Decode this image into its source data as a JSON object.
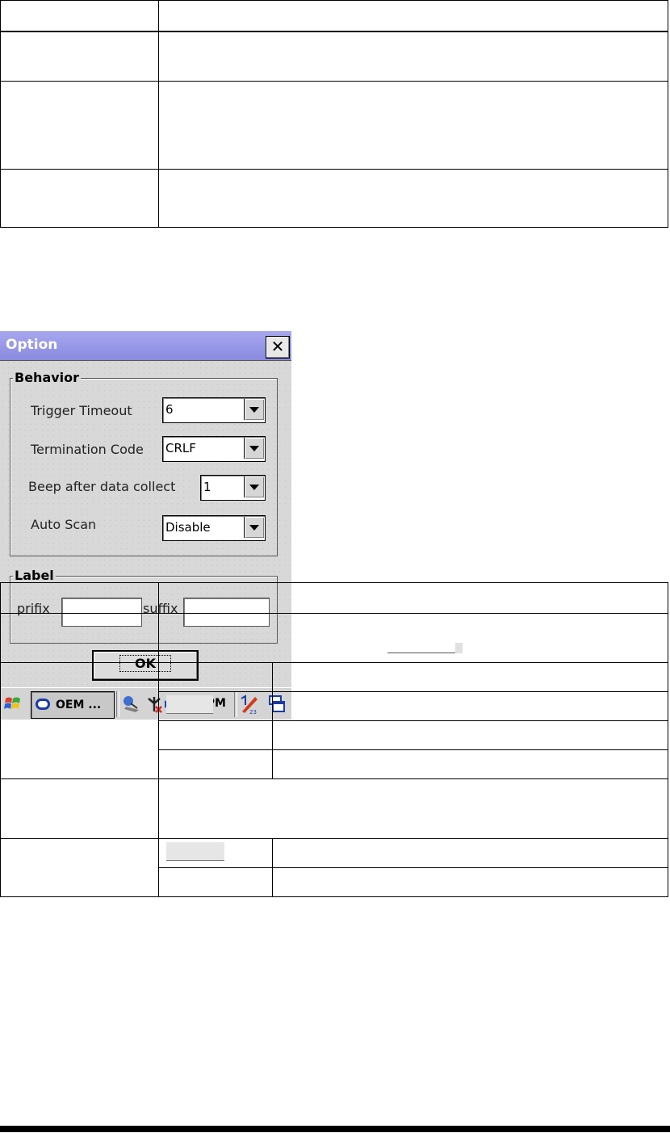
{
  "dialog": {
    "title": "Option",
    "close_label": "✕",
    "behavior": {
      "legend": "Behavior",
      "fields": [
        {
          "label": "Trigger Timeout",
          "value": "6"
        },
        {
          "label": "Termination Code",
          "value": "CRLF"
        },
        {
          "label": "Beep after data collect",
          "value": "1"
        },
        {
          "label": "Auto Scan",
          "value": "Disable"
        }
      ]
    },
    "label_group": {
      "legend": "Label",
      "prefix_label": "prifix",
      "suffix_label": "suffix",
      "prefix_value": "",
      "suffix_value": ""
    },
    "ok_label": "OK"
  },
  "taskbar": {
    "task_label": "OEM ...",
    "clock": "3:36 PM"
  },
  "colors": {
    "titlebar": "#8a8ae0",
    "dialog_bg": "#d8d8d8",
    "task_icon": "#1a3aa8"
  }
}
